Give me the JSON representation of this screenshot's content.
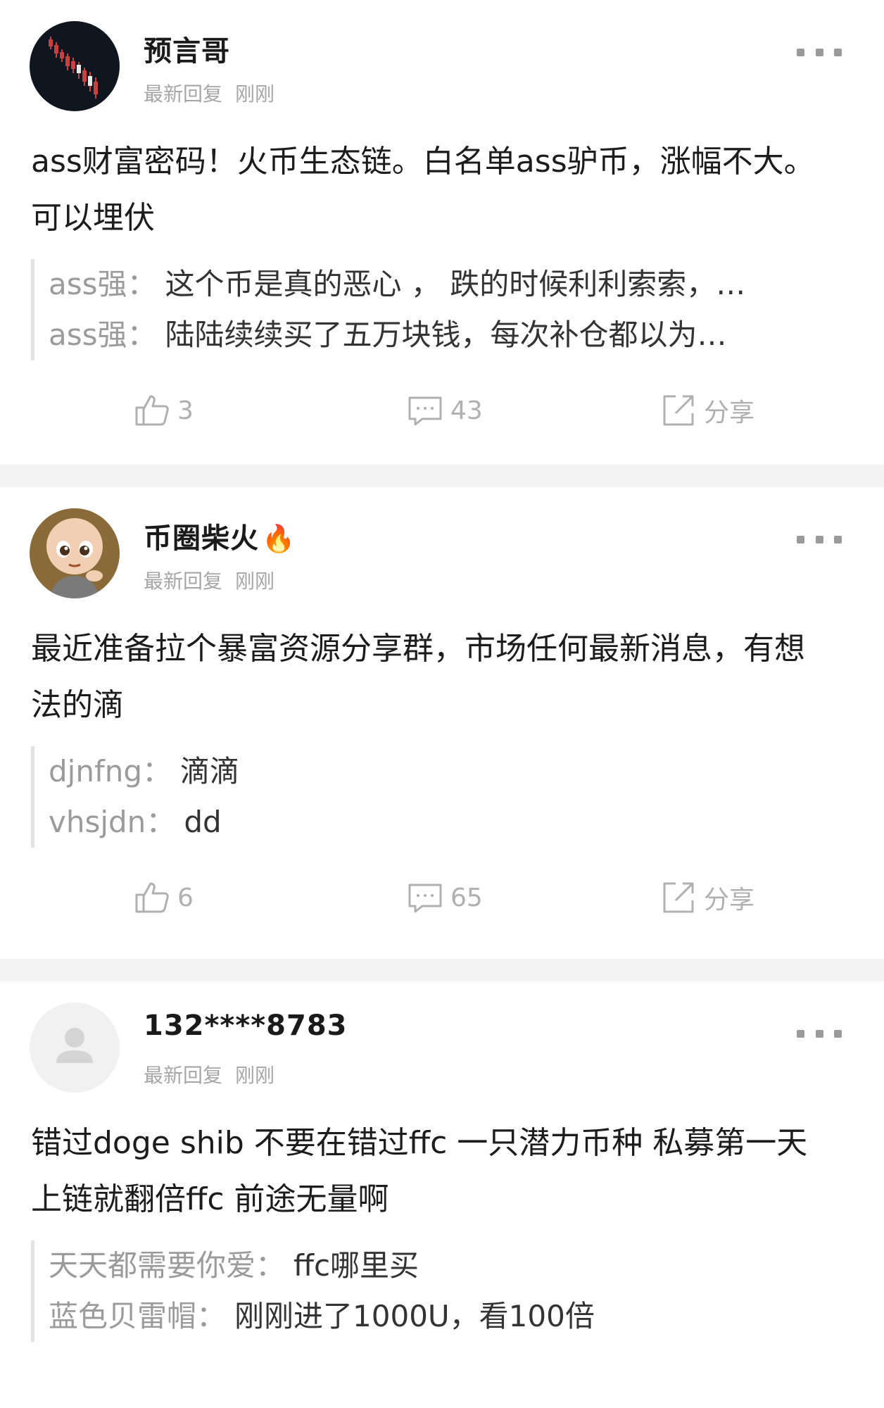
{
  "posts": [
    {
      "username": "预言哥",
      "badge": "",
      "meta_label": "最新回复",
      "meta_time": "刚刚",
      "content": "ass财富密码！火币生态链。白名单ass驴币，涨幅不大。可以埋伏",
      "replies": [
        {
          "name": "ass强",
          "colon": "：",
          "text": "这个币是真的恶心 ， 跌的时候利利索索，…"
        },
        {
          "name": "ass强",
          "colon": "：",
          "text": "陆陆续续买了五万块钱，每次补仓都以为…"
        }
      ],
      "likes": "3",
      "comments": "43",
      "share_label": "分享",
      "avatar_icon": "chart-avatar-icon"
    },
    {
      "username": "币圈柴火",
      "badge": "🔥",
      "meta_label": "最新回复",
      "meta_time": "刚刚",
      "content": "最近准备拉个暴富资源分享群，市场任何最新消息，有想法的滴",
      "replies": [
        {
          "name": "djnfng",
          "colon": "：",
          "text": "滴滴"
        },
        {
          "name": "vhsjdn",
          "colon": "：",
          "text": "dd"
        }
      ],
      "likes": "6",
      "comments": "65",
      "share_label": "分享",
      "avatar_icon": "cartoon-monk-avatar-icon"
    },
    {
      "username": "132****8783",
      "badge": "",
      "meta_label": "最新回复",
      "meta_time": "刚刚",
      "content": "错过doge shib 不要在错过ffc 一只潜力币种 私募第一天上链就翻倍ffc 前途无量啊",
      "replies": [
        {
          "name": "天天都需要你爱",
          "colon": "：",
          "text": "ffc哪里买"
        },
        {
          "name": "蓝色贝雷帽",
          "colon": "：",
          "text": "刚刚进了1000U，看100倍"
        }
      ],
      "likes": "",
      "comments": "",
      "share_label": "",
      "avatar_icon": "default-user-avatar-icon"
    }
  ],
  "icons": {
    "more": "more-dots-icon",
    "like": "thumbs-up-icon",
    "comment": "comment-bubble-icon",
    "share": "share-arrow-icon"
  },
  "colors": {
    "divider": "#f4f4f4",
    "meta": "#a6a6a6",
    "action": "#b0b0b0"
  }
}
